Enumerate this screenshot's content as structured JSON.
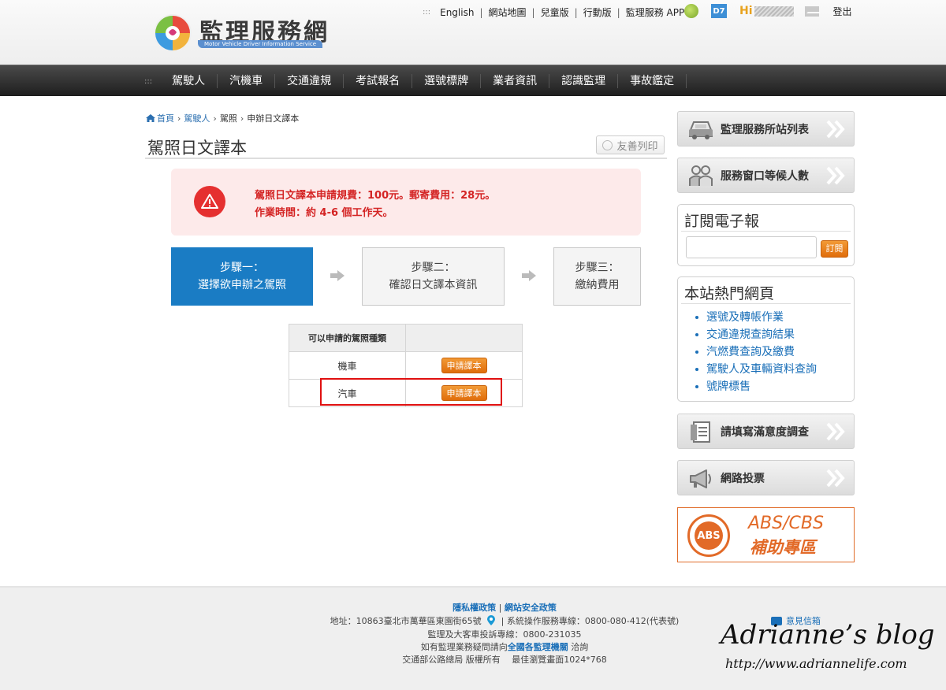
{
  "header": {
    "logo_title": "監理服務網",
    "logo_subtitle": "Motor Vehicle Driver Information Service",
    "top_links": [
      "English",
      "網站地圖",
      "兒童版",
      "行動版",
      "監理服務 APP"
    ],
    "greeting": "Hi",
    "logout": "登出",
    "icon_blue_text": "D7"
  },
  "nav": {
    "items": [
      "駕駛人",
      "汽機車",
      "交通違規",
      "考試報名",
      "選號標牌",
      "業者資訊",
      "認識監理",
      "事故鑑定"
    ]
  },
  "breadcrumb": {
    "home": "首頁",
    "level1": "駕駛人",
    "level2": "駕照",
    "current": "申辦日文譯本"
  },
  "page": {
    "title": "駕照日文譯本",
    "print_label": "友善列印"
  },
  "alert": {
    "line1": "駕照日文譯本申請規費：100元。郵寄費用：28元。",
    "line2": "作業時間：約 4-6 個工作天。"
  },
  "steps": [
    {
      "line1": "步驟一：",
      "line2": "選擇欲申辦之駕照",
      "active": true
    },
    {
      "line1": "步驟二：",
      "line2": "確認日文譯本資訊",
      "active": false
    },
    {
      "line1": "步驟三：",
      "line2": "繳納費用",
      "active": false
    }
  ],
  "license_table": {
    "header": "可以申請的駕照種類",
    "rows": [
      {
        "type": "機車",
        "button": "申請譯本"
      },
      {
        "type": "汽車",
        "button": "申請譯本"
      }
    ]
  },
  "sidebar": {
    "station_list": "監理服務所站列表",
    "queue": "服務窗口等候人數",
    "newsletter_title": "訂閱電子報",
    "newsletter_button": "訂閱",
    "newsletter_value": "",
    "hot_title": "本站熱門網頁",
    "hot_links": [
      "選號及轉帳作業",
      "交通違規查詢結果",
      "汽燃費查詢及繳費",
      "駕駛人及車輛資料查詢",
      "號牌標售"
    ],
    "survey": "請填寫滿意度調查",
    "vote": "網路投票",
    "abs_circle": "ABS",
    "abs_line1": "ABS/CBS",
    "abs_line2": "補助專區"
  },
  "footer": {
    "privacy": "隱私權政策",
    "security": "網站安全政策",
    "address": "地址：10863臺北市萬華區東園街65號",
    "service_line": "系統操作服務專線：0800-080-412(代表號)",
    "complaint": "監理及大客車投訴專線：0800-231035",
    "inquiry_prefix": "如有監理業務疑問請向",
    "inquiry_link": "全國各監理機關",
    "inquiry_suffix": " 洽詢",
    "copyright": "交通部公路總局 版權所有　 最佳瀏覽畫面1024*768",
    "mailbox": "意見信箱"
  },
  "watermark": {
    "blog": "Adrianne’s blog",
    "url": "http://www.adriannelife.com"
  },
  "colors": {
    "nav_bg": "#2a2a2a",
    "step_active": "#1a7cc4",
    "alert_bg": "#fdeaea",
    "alert_text": "#d42424",
    "button_orange": "#e8800f",
    "link_blue": "#1a6fb8",
    "highlight_red": "#e01010"
  }
}
